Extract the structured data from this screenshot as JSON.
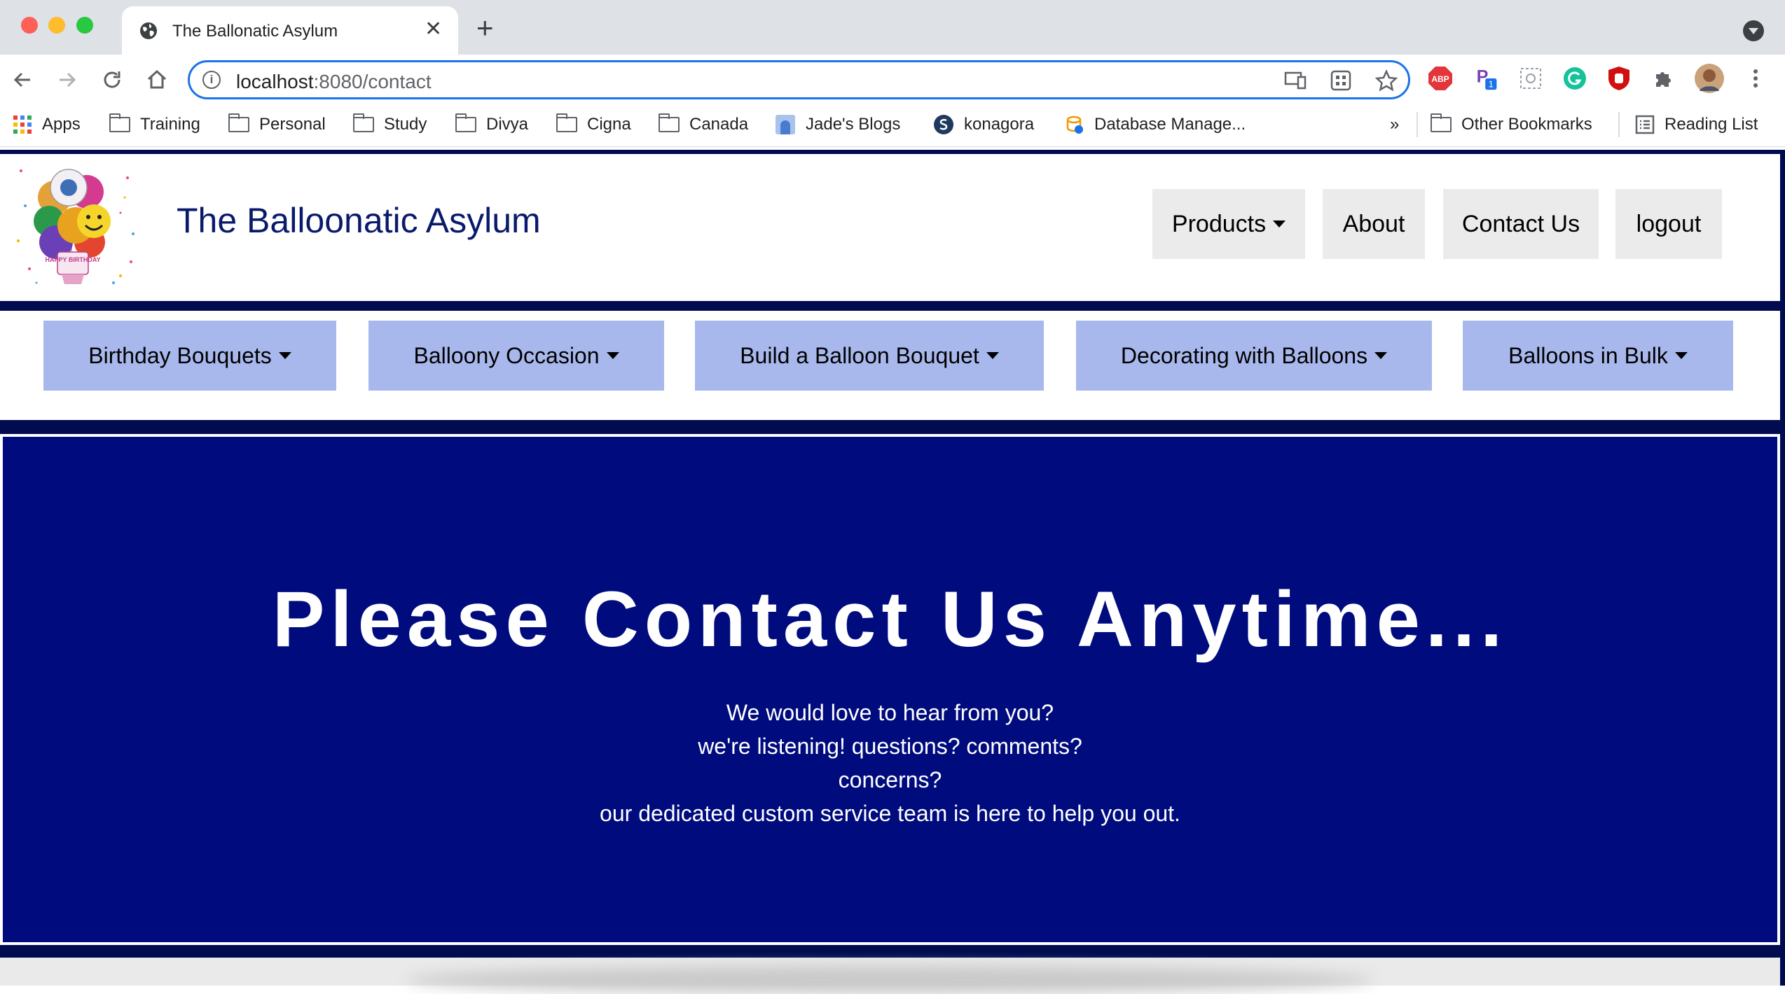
{
  "browser": {
    "tab_title": "The Ballonatic Asylum",
    "url_host": "localhost",
    "url_rest": ":8080/contact",
    "bookmarks": [
      {
        "label": "Apps",
        "icon": "apps-grid-icon"
      },
      {
        "label": "Training",
        "icon": "folder-icon"
      },
      {
        "label": "Personal",
        "icon": "folder-icon"
      },
      {
        "label": "Study",
        "icon": "folder-icon"
      },
      {
        "label": "Divya",
        "icon": "folder-icon"
      },
      {
        "label": "Cigna",
        "icon": "folder-icon"
      },
      {
        "label": "Canada",
        "icon": "folder-icon"
      },
      {
        "label": "Jade's Blogs",
        "icon": "blog-favicon-icon"
      },
      {
        "label": "konagora",
        "icon": "konagora-favicon-icon"
      },
      {
        "label": "Database Manage...",
        "icon": "database-favicon-icon"
      }
    ],
    "overflow": "»",
    "other_bookmarks": "Other Bookmarks",
    "reading_list": "Reading List",
    "extension_badge": "1",
    "abp_label": "ABP"
  },
  "site": {
    "title": "The Balloonatic Asylum",
    "logo_text": "HAPPY BIRTHDAY",
    "top_nav": [
      {
        "label": "Products",
        "dropdown": true
      },
      {
        "label": "About",
        "dropdown": false
      },
      {
        "label": "Contact Us",
        "dropdown": false
      },
      {
        "label": "logout",
        "dropdown": false
      }
    ],
    "categories": [
      "Birthday Bouquets",
      "Balloony Occasion",
      "Build a Balloon Bouquet",
      "Decorating with Balloons",
      "Balloons in Bulk"
    ]
  },
  "hero": {
    "heading": "Please Contact Us Anytime...",
    "lines": [
      "We would love to hear from you?",
      "we're listening! questions? comments?",
      "concerns?",
      "our dedicated custom service team is here to help you out."
    ]
  },
  "colors": {
    "navy_band": "#000c4f",
    "hero_bg": "#000c7e",
    "category_btn": "#a8b8ec",
    "topnav_btn": "#ebebeb",
    "title_text": "#0a1a6b"
  }
}
